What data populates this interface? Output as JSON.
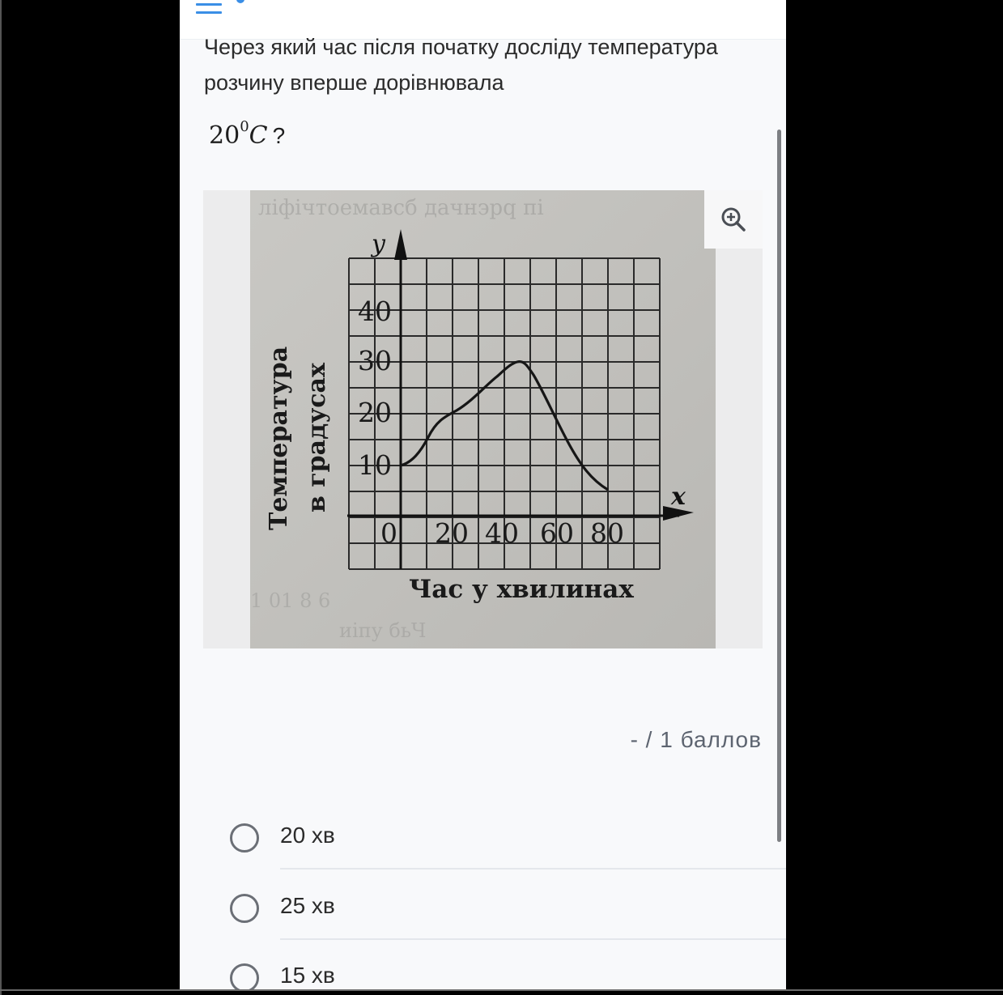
{
  "question": {
    "text": "Через який час після початку досліду температура розчину вперше дорівнювала",
    "formula_value": "20",
    "formula_sup": "0",
    "formula_unit": "C",
    "formula_end": "?"
  },
  "figure": {
    "y_axis_letter": "y",
    "x_axis_letter": "x",
    "y_label_line1": "Температура",
    "y_label_line2": "в градусах",
    "x_label": "Час у хвилинах",
    "y_ticks": [
      "40",
      "30",
      "20",
      "10"
    ],
    "x_ticks": [
      "0",
      "20",
      "40",
      "60",
      "80"
    ],
    "zoom_icon": "zoom-in-icon"
  },
  "score": {
    "text": "- / 1 баллов"
  },
  "options": [
    {
      "label": "20 хв"
    },
    {
      "label": "25 хв"
    },
    {
      "label": "15 хв"
    }
  ],
  "colors": {
    "accent": "#3a8ee6",
    "page_bg": "#f8f9fb",
    "frame_bg": "#000000",
    "text": "#2b2b2b"
  }
}
